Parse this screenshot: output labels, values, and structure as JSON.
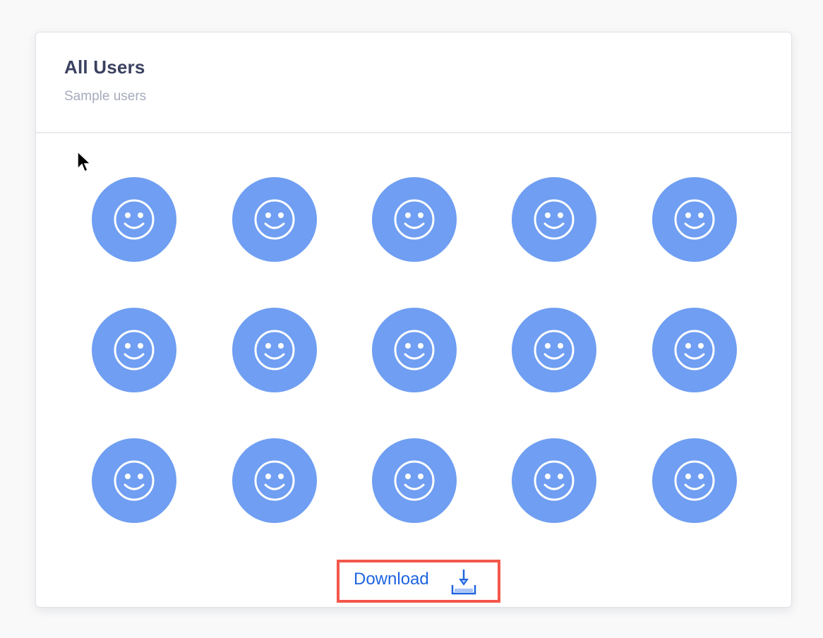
{
  "card": {
    "title": "All Users",
    "subtitle": "Sample users"
  },
  "users": {
    "count": 15,
    "columns": 5,
    "rows": 3,
    "avatar_icon": "smiley-face-icon",
    "avatar_color": "#6f9ef2"
  },
  "download": {
    "label": "Download",
    "icon": "download-icon",
    "text_color": "#1f64e0",
    "highlight_border_color": "#f4574b"
  }
}
